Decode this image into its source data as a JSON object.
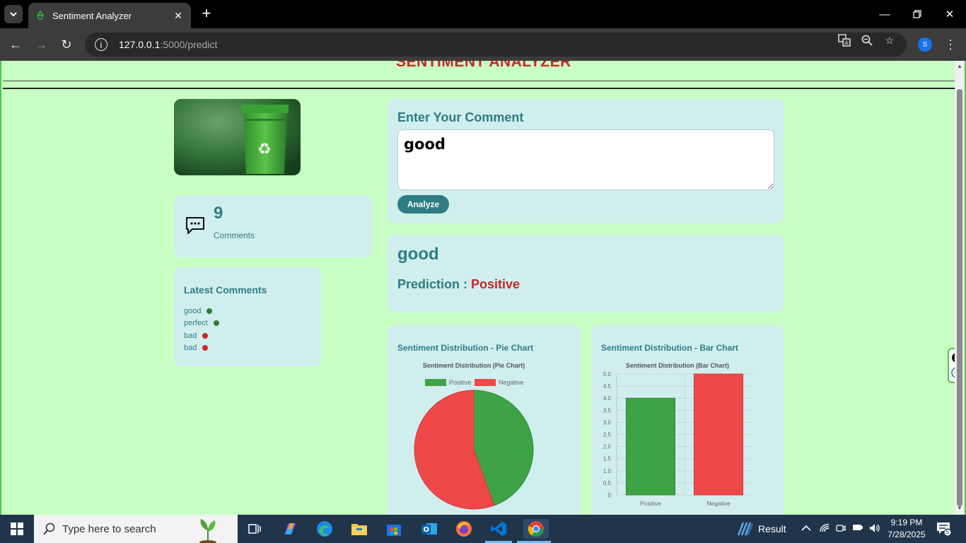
{
  "browser": {
    "tab_title": "Sentiment Analyzer",
    "url_host": "127.0.0.1",
    "url_path": ":5000/predict",
    "profile_initial": "S"
  },
  "page": {
    "heading": "SENTIMENT ANALYZER",
    "comment_count": "9",
    "comment_count_label": "Comments",
    "latest_title": "Latest Comments",
    "latest_comments": [
      {
        "text": "good",
        "sentiment": "positive"
      },
      {
        "text": "perfect",
        "sentiment": "positive"
      },
      {
        "text": "bad",
        "sentiment": "negative"
      },
      {
        "text": "bad",
        "sentiment": "negative"
      }
    ],
    "input_title": "Enter Your Comment",
    "input_value": "good",
    "analyze_label": "Analyze",
    "result_echo": "good",
    "prediction_label": "Prediction : ",
    "prediction_value": "Positive",
    "pie_card_title": "Sentiment Distribution - Pie Chart",
    "bar_card_title": "Sentiment Distribution - Bar Chart"
  },
  "colors": {
    "positive": "#3ea346",
    "negative": "#ef4848",
    "accent": "#2e7d82",
    "page_bg": "#c8ffc4",
    "card_bg": "#d1eeee"
  },
  "chart_data": [
    {
      "type": "pie",
      "title": "Sentiment Distribution (Pie Chart)",
      "categories": [
        "Positive",
        "Negative"
      ],
      "values": [
        4,
        5
      ],
      "legend": "top"
    },
    {
      "type": "bar",
      "title": "Sentiment Distribution (Bar Chart)",
      "categories": [
        "Positive",
        "Negative"
      ],
      "values": [
        4,
        5
      ],
      "ylim": [
        0,
        5
      ],
      "yticks": [
        "0",
        "0.5",
        "1.0",
        "1.5",
        "2.0",
        "2.5",
        "3.0",
        "3.5",
        "4.0",
        "4.5",
        "5.0"
      ],
      "grid": true
    }
  ],
  "taskbar": {
    "search_placeholder": "Type here to search",
    "weather_label": "Result",
    "time": "9:19 PM",
    "date": "7/28/2025",
    "notification_count": "5"
  }
}
